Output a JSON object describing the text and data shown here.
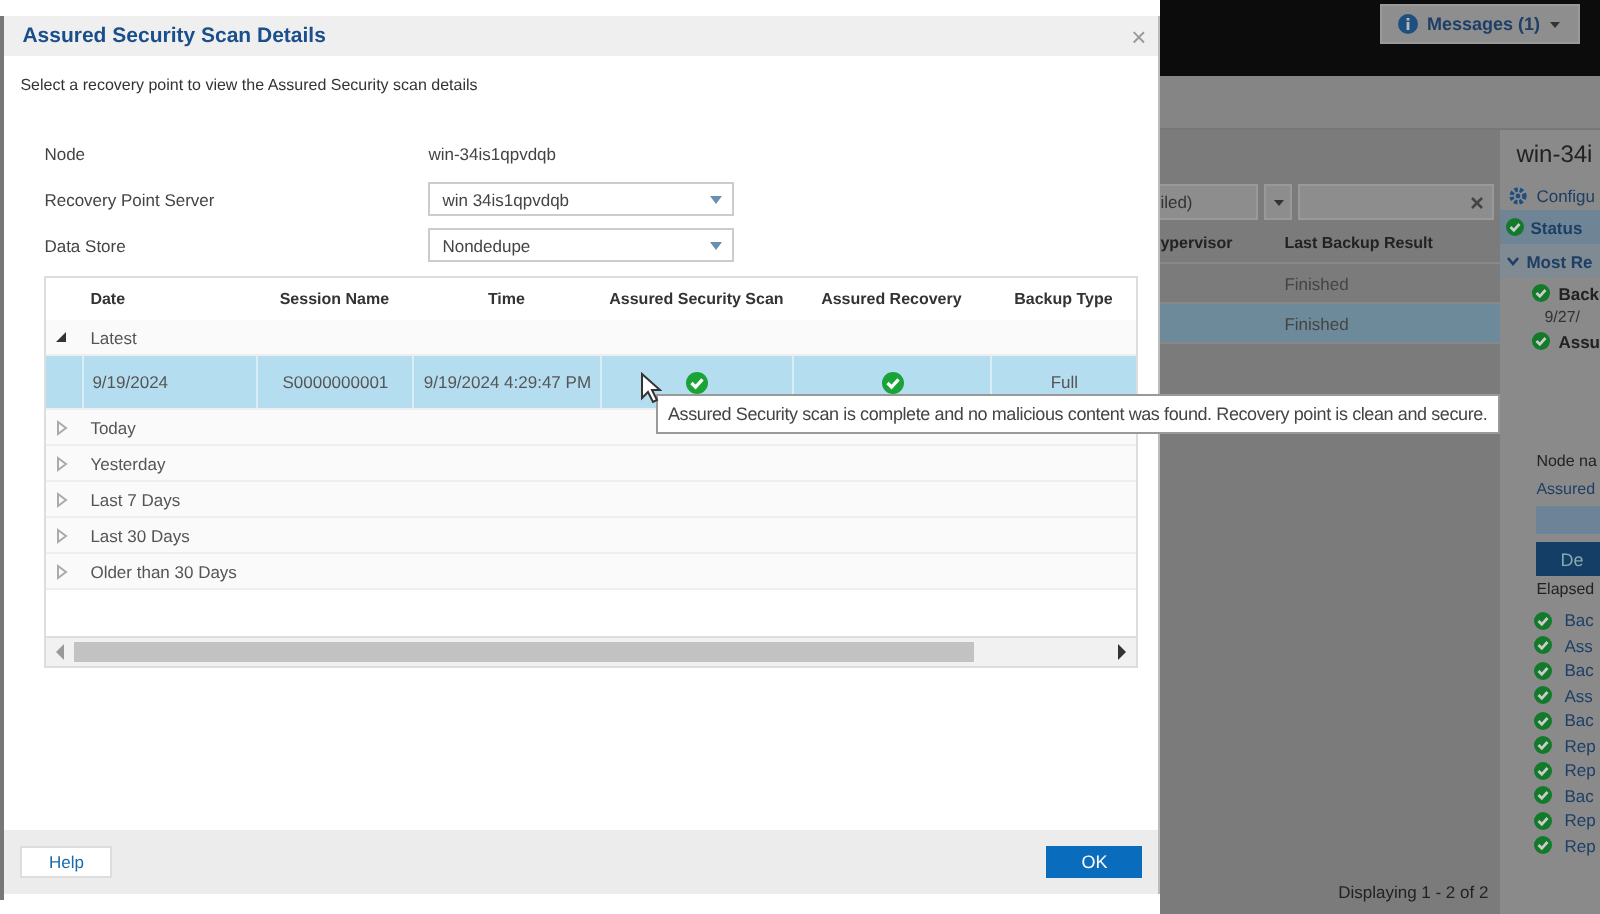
{
  "dialog": {
    "title": "Assured Security Scan Details",
    "close": "×",
    "instruction": "Select a recovery point to view the Assured Security scan details",
    "fields": [
      {
        "kind": "text",
        "label": "Node",
        "value": "win-34is1qpvdqb"
      },
      {
        "kind": "dropdown",
        "label": "Recovery Point Server",
        "value": "win 34is1qpvdqb"
      },
      {
        "kind": "dropdown",
        "label": "Data Store",
        "value": "Nondedupe"
      }
    ],
    "table": {
      "columns": [
        "Date",
        "Session Name",
        "Time",
        "Assured Security Scan",
        "Assured Recovery",
        "Backup Type"
      ],
      "groups": [
        {
          "label": "Latest",
          "expanded": true,
          "rows": [
            {
              "date": "9/19/2024",
              "session": "S0000000001",
              "time": "9/19/2024 4:29:47 PM",
              "security_scan_passed": true,
              "recovery_passed": true,
              "backup_type": "Full",
              "selected": true
            }
          ]
        },
        {
          "label": "Today",
          "expanded": false
        },
        {
          "label": "Yesterday",
          "expanded": false
        },
        {
          "label": "Last 7 Days",
          "expanded": false
        },
        {
          "label": "Last 30 Days",
          "expanded": false
        },
        {
          "label": "Older than 30 Days",
          "expanded": false
        }
      ]
    },
    "tooltip": "Assured Security scan is complete and no malicious content was found. Recovery point is clean and secure.",
    "help_button": "Help",
    "ok_button": "OK"
  },
  "background": {
    "messages_button": "Messages (1)",
    "filter_value": "iled)",
    "columns": [
      "ypervisor",
      "Last Backup Result"
    ],
    "rows": [
      {
        "result": "Finished",
        "selected": false
      },
      {
        "result": "Finished",
        "selected": true
      }
    ],
    "footer": "Displaying 1 - 2 of 2",
    "side_panel": {
      "title": "win-34i",
      "items": [
        {
          "kind": "gear-link",
          "text": "Configu"
        },
        {
          "kind": "header",
          "text": "Status"
        },
        {
          "kind": "section",
          "text": "Most Re"
        },
        {
          "kind": "check-bold",
          "text": "Back"
        },
        {
          "kind": "sub",
          "text": "9/27/"
        },
        {
          "kind": "check-bold",
          "text": "Assu"
        },
        {
          "kind": "gap"
        },
        {
          "kind": "label",
          "text": "Node na"
        },
        {
          "kind": "link",
          "text": "Assured"
        },
        {
          "kind": "bar"
        },
        {
          "kind": "button",
          "text": "De"
        },
        {
          "kind": "label",
          "text": "Elapsed"
        },
        {
          "kind": "check-link",
          "text": "Bac"
        },
        {
          "kind": "check-link",
          "text": "Ass"
        },
        {
          "kind": "check-link",
          "text": "Bac"
        },
        {
          "kind": "check-link",
          "text": "Ass"
        },
        {
          "kind": "check-link",
          "text": "Bac"
        },
        {
          "kind": "check-link",
          "text": "Rep"
        },
        {
          "kind": "check-link",
          "text": "Rep"
        },
        {
          "kind": "check-link",
          "text": "Bac"
        },
        {
          "kind": "check-link",
          "text": "Rep"
        },
        {
          "kind": "check-link",
          "text": "Rep"
        }
      ]
    }
  }
}
